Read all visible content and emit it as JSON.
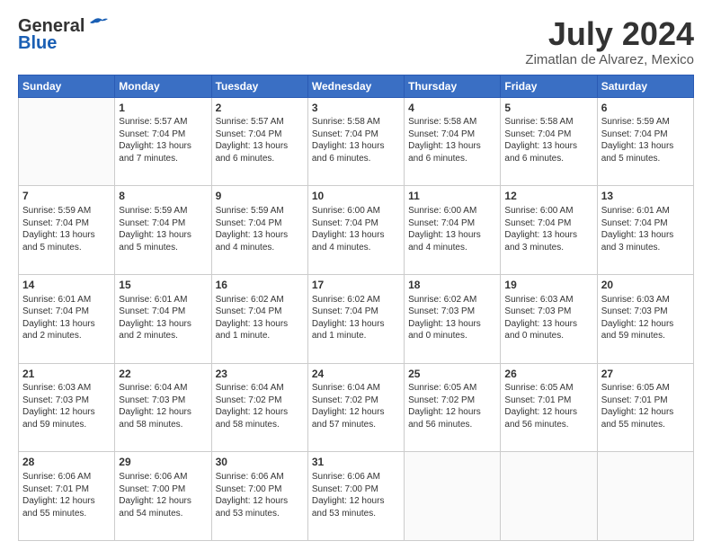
{
  "header": {
    "logo_general": "General",
    "logo_blue": "Blue",
    "month_year": "July 2024",
    "location": "Zimatlan de Alvarez, Mexico"
  },
  "columns": [
    "Sunday",
    "Monday",
    "Tuesday",
    "Wednesday",
    "Thursday",
    "Friday",
    "Saturday"
  ],
  "weeks": [
    [
      {
        "num": "",
        "content": ""
      },
      {
        "num": "1",
        "content": "Sunrise: 5:57 AM\nSunset: 7:04 PM\nDaylight: 13 hours\nand 7 minutes."
      },
      {
        "num": "2",
        "content": "Sunrise: 5:57 AM\nSunset: 7:04 PM\nDaylight: 13 hours\nand 6 minutes."
      },
      {
        "num": "3",
        "content": "Sunrise: 5:58 AM\nSunset: 7:04 PM\nDaylight: 13 hours\nand 6 minutes."
      },
      {
        "num": "4",
        "content": "Sunrise: 5:58 AM\nSunset: 7:04 PM\nDaylight: 13 hours\nand 6 minutes."
      },
      {
        "num": "5",
        "content": "Sunrise: 5:58 AM\nSunset: 7:04 PM\nDaylight: 13 hours\nand 6 minutes."
      },
      {
        "num": "6",
        "content": "Sunrise: 5:59 AM\nSunset: 7:04 PM\nDaylight: 13 hours\nand 5 minutes."
      }
    ],
    [
      {
        "num": "7",
        "content": "Sunrise: 5:59 AM\nSunset: 7:04 PM\nDaylight: 13 hours\nand 5 minutes."
      },
      {
        "num": "8",
        "content": "Sunrise: 5:59 AM\nSunset: 7:04 PM\nDaylight: 13 hours\nand 5 minutes."
      },
      {
        "num": "9",
        "content": "Sunrise: 5:59 AM\nSunset: 7:04 PM\nDaylight: 13 hours\nand 4 minutes."
      },
      {
        "num": "10",
        "content": "Sunrise: 6:00 AM\nSunset: 7:04 PM\nDaylight: 13 hours\nand 4 minutes."
      },
      {
        "num": "11",
        "content": "Sunrise: 6:00 AM\nSunset: 7:04 PM\nDaylight: 13 hours\nand 4 minutes."
      },
      {
        "num": "12",
        "content": "Sunrise: 6:00 AM\nSunset: 7:04 PM\nDaylight: 13 hours\nand 3 minutes."
      },
      {
        "num": "13",
        "content": "Sunrise: 6:01 AM\nSunset: 7:04 PM\nDaylight: 13 hours\nand 3 minutes."
      }
    ],
    [
      {
        "num": "14",
        "content": "Sunrise: 6:01 AM\nSunset: 7:04 PM\nDaylight: 13 hours\nand 2 minutes."
      },
      {
        "num": "15",
        "content": "Sunrise: 6:01 AM\nSunset: 7:04 PM\nDaylight: 13 hours\nand 2 minutes."
      },
      {
        "num": "16",
        "content": "Sunrise: 6:02 AM\nSunset: 7:04 PM\nDaylight: 13 hours\nand 1 minute."
      },
      {
        "num": "17",
        "content": "Sunrise: 6:02 AM\nSunset: 7:04 PM\nDaylight: 13 hours\nand 1 minute."
      },
      {
        "num": "18",
        "content": "Sunrise: 6:02 AM\nSunset: 7:03 PM\nDaylight: 13 hours\nand 0 minutes."
      },
      {
        "num": "19",
        "content": "Sunrise: 6:03 AM\nSunset: 7:03 PM\nDaylight: 13 hours\nand 0 minutes."
      },
      {
        "num": "20",
        "content": "Sunrise: 6:03 AM\nSunset: 7:03 PM\nDaylight: 12 hours\nand 59 minutes."
      }
    ],
    [
      {
        "num": "21",
        "content": "Sunrise: 6:03 AM\nSunset: 7:03 PM\nDaylight: 12 hours\nand 59 minutes."
      },
      {
        "num": "22",
        "content": "Sunrise: 6:04 AM\nSunset: 7:03 PM\nDaylight: 12 hours\nand 58 minutes."
      },
      {
        "num": "23",
        "content": "Sunrise: 6:04 AM\nSunset: 7:02 PM\nDaylight: 12 hours\nand 58 minutes."
      },
      {
        "num": "24",
        "content": "Sunrise: 6:04 AM\nSunset: 7:02 PM\nDaylight: 12 hours\nand 57 minutes."
      },
      {
        "num": "25",
        "content": "Sunrise: 6:05 AM\nSunset: 7:02 PM\nDaylight: 12 hours\nand 56 minutes."
      },
      {
        "num": "26",
        "content": "Sunrise: 6:05 AM\nSunset: 7:01 PM\nDaylight: 12 hours\nand 56 minutes."
      },
      {
        "num": "27",
        "content": "Sunrise: 6:05 AM\nSunset: 7:01 PM\nDaylight: 12 hours\nand 55 minutes."
      }
    ],
    [
      {
        "num": "28",
        "content": "Sunrise: 6:06 AM\nSunset: 7:01 PM\nDaylight: 12 hours\nand 55 minutes."
      },
      {
        "num": "29",
        "content": "Sunrise: 6:06 AM\nSunset: 7:00 PM\nDaylight: 12 hours\nand 54 minutes."
      },
      {
        "num": "30",
        "content": "Sunrise: 6:06 AM\nSunset: 7:00 PM\nDaylight: 12 hours\nand 53 minutes."
      },
      {
        "num": "31",
        "content": "Sunrise: 6:06 AM\nSunset: 7:00 PM\nDaylight: 12 hours\nand 53 minutes."
      },
      {
        "num": "",
        "content": ""
      },
      {
        "num": "",
        "content": ""
      },
      {
        "num": "",
        "content": ""
      }
    ]
  ]
}
